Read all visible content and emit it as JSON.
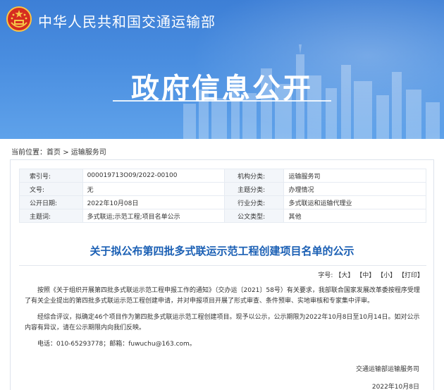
{
  "header": {
    "org_name": "中华人民共和国交通运输部",
    "hero_title": "政府信息公开"
  },
  "breadcrumb": {
    "prefix": "当前位置：",
    "home": "首页",
    "separator": ">",
    "section": "运输服务司"
  },
  "meta": {
    "rows": [
      {
        "k1": "索引号:",
        "v1": "000019713O09/2022-00100",
        "k2": "机构分类:",
        "v2": "运输服务司"
      },
      {
        "k1": "文号:",
        "v1": "无",
        "k2": "主题分类:",
        "v2": "办理情况"
      },
      {
        "k1": "公开日期:",
        "v1": "2022年10月08日",
        "k2": "行业分类:",
        "v2": "多式联运和运输代理业"
      },
      {
        "k1": "主题词:",
        "v1": "多式联运;示范工程;项目名单公示",
        "k2": "公文类型:",
        "v2": "其他"
      }
    ]
  },
  "article": {
    "title": "关于拟公布第四批多式联运示范工程创建项目名单的公示",
    "font_size": {
      "label": "字号:",
      "large": "【大】",
      "medium": "【中】",
      "small": "【小】",
      "print": "【打印】"
    },
    "paragraphs": [
      "按照《关于组织开展第四批多式联运示范工程申报工作的通知》（交办运〔2021〕58号）有关要求，我部联合国家发展改革委按程序受理了有关企业提出的第四批多式联运示范工程创建申请，并对申报项目开展了形式审查、条件预审、实地审核和专家集中评审。",
      "经综合评议，拟确定46个项目作为第四批多式联运示范工程创建项目。现予以公示，公示期限为2022年10月8日至10月14日。如对公示内容有异议，请在公示期限内向我们反映。"
    ],
    "contact": "电话：010-65293778；邮箱：fuwuchu@163.com。",
    "signature": "交通运输部运输服务司",
    "date": "2022年10月8日"
  }
}
